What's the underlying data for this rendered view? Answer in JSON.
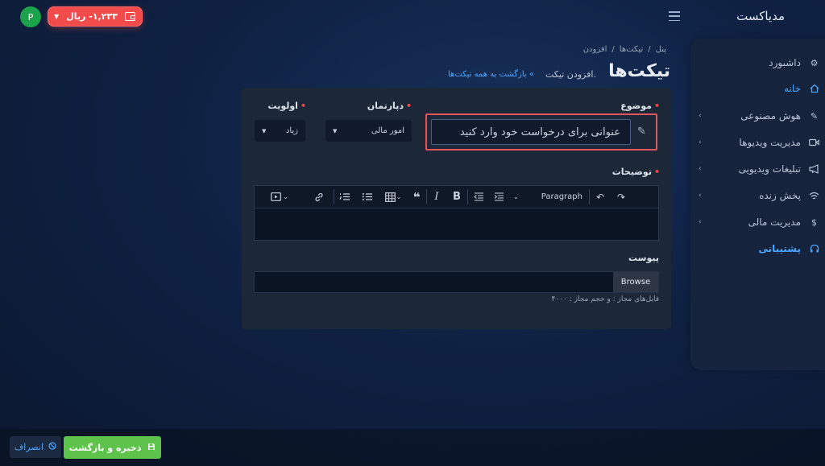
{
  "app": {
    "brand": "مدیاکست",
    "avatar_letter": "P"
  },
  "wallet": {
    "amount": "۱,۲۳۳-",
    "currency": "ریال",
    "color": "#f14b4b"
  },
  "sidebar": {
    "items": [
      {
        "label": "داشبورد",
        "icon": "gear-icon"
      },
      {
        "label": "خانه",
        "icon": "home-icon"
      },
      {
        "label": "هوش مصنوعی",
        "icon": "magic-wand-icon"
      },
      {
        "label": "مدیریت ویدیوها",
        "icon": "video-icon"
      },
      {
        "label": "تبلیغات ویدیویی",
        "icon": "megaphone-icon"
      },
      {
        "label": "پخش زنده",
        "icon": "wifi-icon"
      },
      {
        "label": "مدیریت مالی",
        "icon": "dollar-icon"
      },
      {
        "label": "پشتیبانی",
        "icon": "headset-icon"
      }
    ]
  },
  "breadcrumb": {
    "items": [
      "پنل",
      "تیکت‌ها",
      "افزودن"
    ],
    "separator": "/"
  },
  "header": {
    "title": "تیکت‌ها",
    "subtitle": "افزودن تیکت.",
    "back_link": "بازگشت به همه تیکت‌ها"
  },
  "form": {
    "subject_label": "موضوع",
    "subject_placeholder": "عنوانی برای درخواست خود وارد کنید",
    "department_label": "دپارتمان",
    "department_value": "امور مالی",
    "priority_label": "اولویت",
    "priority_value": "زیاد",
    "description_label": "توضیحات",
    "editor_paragraph": "Paragraph",
    "attachment_label": "پیوست",
    "browse_label": "Browse",
    "file_hint": "فایل‌های مجاز : و حجم مجاز : ۴۰۰۰"
  },
  "footer": {
    "save_label": "ذخیره و بازگشت",
    "cancel_label": "انصراف"
  },
  "colors": {
    "accent": "#4ba6ff",
    "danger": "#f14b4b",
    "success": "#5dc34a"
  }
}
